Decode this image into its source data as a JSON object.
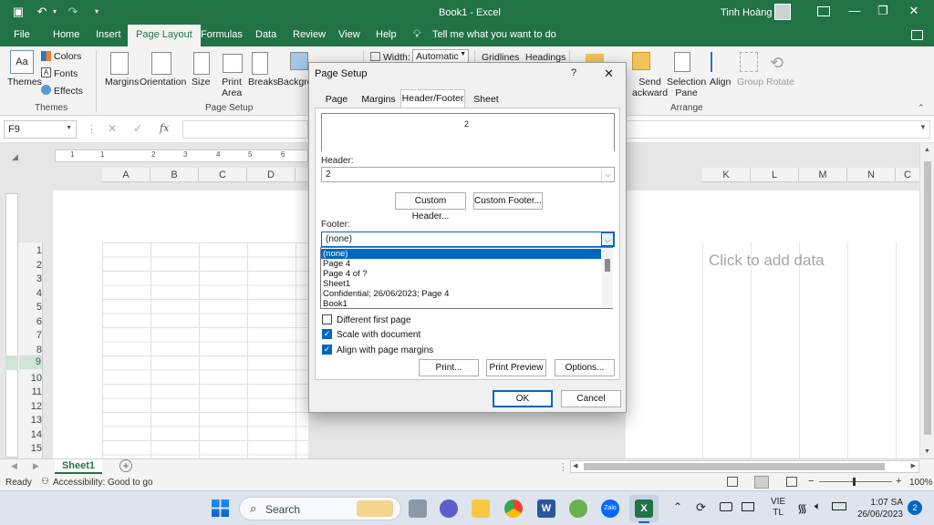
{
  "app": {
    "doc_title": "Book1",
    "app_name": "Excel",
    "user_name": "Tinh Hoàng"
  },
  "tabs": [
    "File",
    "Home",
    "Insert",
    "Page Layout",
    "Formulas",
    "Data",
    "Review",
    "View",
    "Help"
  ],
  "active_tab": "Page Layout",
  "tell_me": "Tell me what you want to do",
  "ribbon": {
    "themes": {
      "themes": "Themes",
      "colors": "Colors",
      "fonts": "Fonts",
      "effects": "Effects",
      "group": "Themes"
    },
    "page_setup": {
      "margins": "Margins",
      "orientation": "Orientation",
      "size": "Size",
      "print_area_1": "Print",
      "print_area_2": "Area",
      "breaks": "Breaks",
      "background": "Backgro",
      "group": "Page Setup"
    },
    "scale": {
      "width_label": "Width:",
      "width_value": "Automatic"
    },
    "sheet_options": {
      "gridlines": "Gridlines",
      "headings": "Headings"
    },
    "arrange": {
      "send_1": "Send",
      "send_2": "ackward",
      "selection_1": "Selection",
      "selection_2": "Pane",
      "align": "Align",
      "group_btn": "Group",
      "rotate": "Rotate",
      "group": "Arrange"
    }
  },
  "formula_bar": {
    "name_box": "F9",
    "fx": "fx"
  },
  "columns_left": [
    "A",
    "B",
    "C",
    "D"
  ],
  "columns_right": [
    "K",
    "L",
    "M",
    "N",
    "C"
  ],
  "rows": [
    "1",
    "2",
    "3",
    "4",
    "5",
    "6",
    "7",
    "8",
    "9",
    "10",
    "11",
    "12",
    "13",
    "14",
    "15"
  ],
  "ruler_numbers": [
    "1",
    "1",
    "2",
    "3",
    "4",
    "5",
    "6"
  ],
  "click_to_add": "Click to add data",
  "sheet_tab": "Sheet1",
  "status": {
    "ready": "Ready",
    "accessibility": "Accessibility: Good to go",
    "zoom": "100%"
  },
  "dialog": {
    "title": "Page Setup",
    "help": "?",
    "tabs": [
      "Page",
      "Margins",
      "Header/Footer",
      "Sheet"
    ],
    "active_tab": "Header/Footer",
    "preview_text": "2",
    "header_label": "Header:",
    "header_value": "2",
    "custom_header": "Custom Header...",
    "custom_footer": "Custom Footer...",
    "footer_label": "Footer:",
    "footer_value": "(none)",
    "footer_options": [
      "(none)",
      "Page 4",
      "Page 4 of ?",
      "Sheet1",
      " Confidential; 26/06/2023; Page 4",
      "Book1"
    ],
    "different_first_page": "Different first page",
    "scale_with_document": "Scale with document",
    "align_with_margins": "Align with page margins",
    "print_btn": "Print...",
    "print_preview_btn": "Print Preview",
    "options_btn": "Options...",
    "ok": "OK",
    "cancel": "Cancel"
  },
  "taskbar": {
    "search": "Search",
    "lang_1": "VIE",
    "lang_2": "TL",
    "time": "1:07 SA",
    "date": "26/06/2023",
    "notif_count": "2"
  },
  "colors": {
    "excel_green": "#217346",
    "accent_blue": "#0067c0"
  }
}
